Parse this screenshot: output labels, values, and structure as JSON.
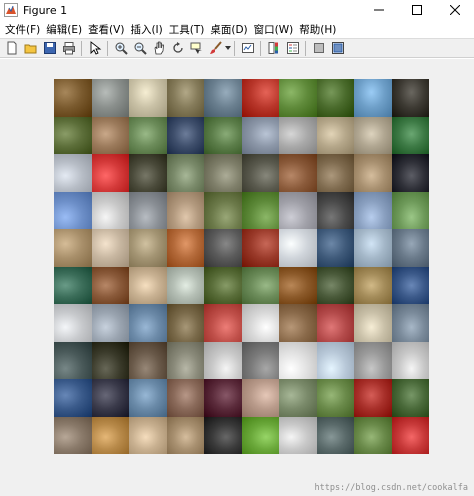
{
  "window": {
    "title": "Figure 1"
  },
  "menu": [
    "文件(F)",
    "编辑(E)",
    "查看(V)",
    "插入(I)",
    "工具(T)",
    "桌面(D)",
    "窗口(W)",
    "帮助(H)"
  ],
  "toolbar_icons": [
    "new-figure-icon",
    "open-file-icon",
    "save-icon",
    "print-icon",
    "select-arrow-icon",
    "zoom-in-icon",
    "zoom-out-icon",
    "pan-hand-icon",
    "rotate-3d-icon",
    "data-cursor-icon",
    "brush-icon",
    "link-plot-icon",
    "colorbar-icon",
    "legend-icon",
    "hide-plot-tools-icon",
    "show-plot-tools-icon"
  ],
  "image_grid": {
    "rows": 10,
    "cols": 10,
    "tiles": [
      [
        "#7a5a2e",
        "#8a8f8c",
        "#c9c1a6",
        "#857b5a",
        "#6a7f8f",
        "#b8362a",
        "#5f8a3a",
        "#4a6b2c",
        "#6e9fc8",
        "#3d3a33"
      ],
      [
        "#5d6f3a",
        "#9c7b5c",
        "#6c8c5a",
        "#3f4f6c",
        "#5c7e4a",
        "#8c97a8",
        "#a9a9a9",
        "#b5a78a",
        "#b0a691",
        "#3d7a45"
      ],
      [
        "#b7bdc6",
        "#d43a3a",
        "#4a4a3a",
        "#7a8a6a",
        "#7f7f6a",
        "#5a5a4e",
        "#8a5a3a",
        "#7f6b4f",
        "#a89070",
        "#2f3038"
      ],
      [
        "#6d8fc8",
        "#c9c9c9",
        "#8a8f95",
        "#b39a7f",
        "#6c7a4a",
        "#5e8a3a",
        "#a0a0a8",
        "#4a4a4a",
        "#8aa0c0",
        "#6e9a5a"
      ],
      [
        "#a88f6a",
        "#c7b6a0",
        "#a39473",
        "#b46a3a",
        "#5a5a5a",
        "#9a3a2a",
        "#cfd4da",
        "#3f5a7a",
        "#a4b7c8",
        "#6a7a8a"
      ],
      [
        "#3c6e5a",
        "#8a5a3a",
        "#c9b293",
        "#b6c0b6",
        "#5a6e3a",
        "#6c8c5a",
        "#8c5a2a",
        "#4a5a3a",
        "#a48c5a",
        "#3c5a8a"
      ],
      [
        "#c7c9cc",
        "#9aa4b0",
        "#6c8aa8",
        "#7a6a4a",
        "#c0504a",
        "#d8d8d8",
        "#8a6a4a",
        "#b34a4a",
        "#c9c0a8",
        "#7a8a9a"
      ],
      [
        "#4a5a5a",
        "#3a3a2a",
        "#6a5a4a",
        "#8a8a7a",
        "#c8c8c8",
        "#7a7a7a",
        "#e0e0e0",
        "#b8c8d8",
        "#9a9a9a",
        "#c8c8c8"
      ],
      [
        "#3a5a8a",
        "#3a3a4a",
        "#6a8aa8",
        "#8a6a5a",
        "#5a2a3a",
        "#b89a8a",
        "#7a8a6a",
        "#6a8a4a",
        "#a8302a",
        "#4a6a3a"
      ],
      [
        "#8a7a6a",
        "#b88a4a",
        "#c8b090",
        "#a89070",
        "#3a3a3a",
        "#6aa83a",
        "#c8c8c8",
        "#5a6a6a",
        "#6a8a4a",
        "#c83a3a"
      ]
    ]
  },
  "watermark": "https://blog.csdn.net/cookalfa"
}
